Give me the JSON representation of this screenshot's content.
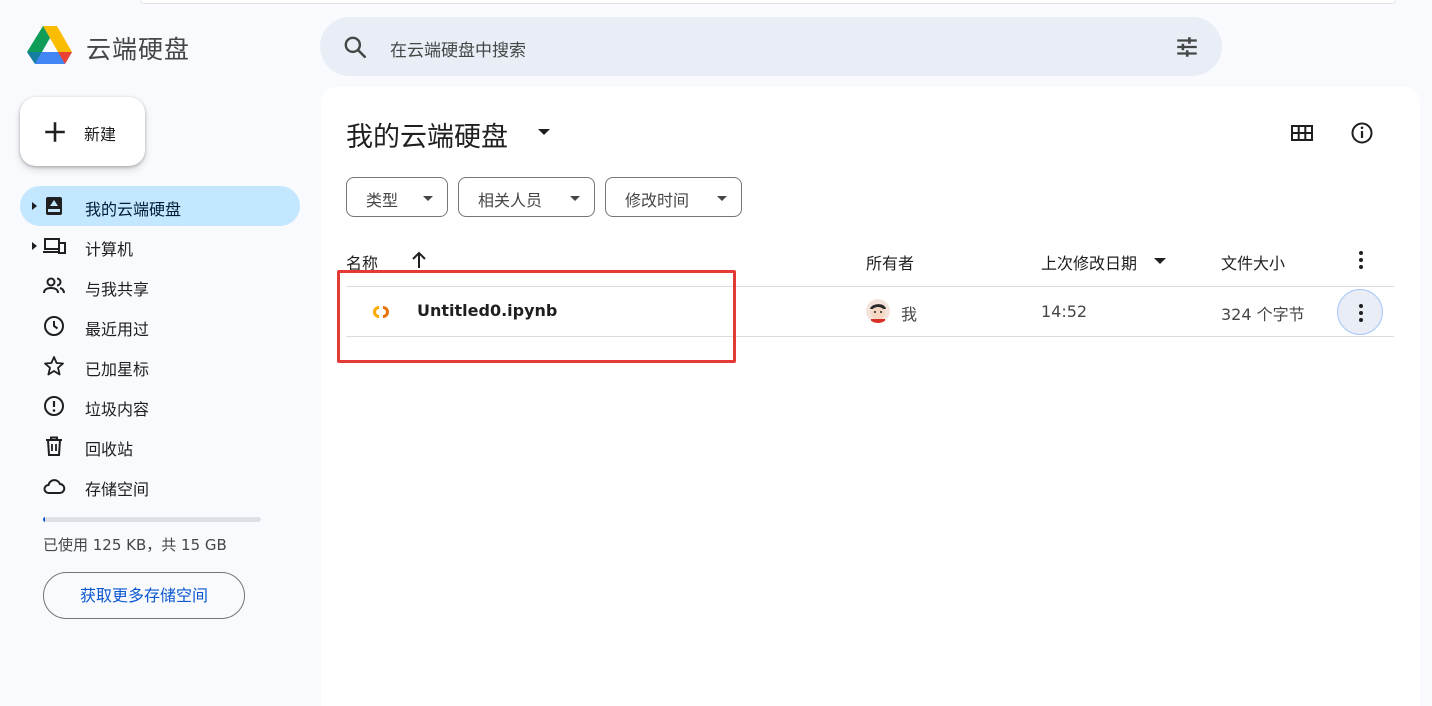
{
  "app": {
    "title": "云端硬盘"
  },
  "search": {
    "placeholder": "在云端硬盘中搜索"
  },
  "new_button": {
    "label": "新建"
  },
  "sidebar": {
    "items": [
      {
        "label": "我的云端硬盘",
        "icon": "my-drive-icon",
        "active": true,
        "expandable": true
      },
      {
        "label": "计算机",
        "icon": "computer-icon",
        "active": false,
        "expandable": true
      },
      {
        "label": "与我共享",
        "icon": "people-icon",
        "active": false
      },
      {
        "label": "最近用过",
        "icon": "clock-icon",
        "active": false
      },
      {
        "label": "已加星标",
        "icon": "star-icon",
        "active": false
      },
      {
        "label": "垃圾内容",
        "icon": "alert-icon",
        "active": false
      },
      {
        "label": "回收站",
        "icon": "trash-icon",
        "active": false
      },
      {
        "label": "存储空间",
        "icon": "cloud-icon",
        "active": false
      }
    ],
    "storage": {
      "used_text": "已使用 125 KB，共 15 GB",
      "used_fraction": 0.01,
      "button_label": "获取更多存储空间"
    }
  },
  "main": {
    "title": "我的云端硬盘",
    "filters": [
      {
        "label": "类型"
      },
      {
        "label": "相关人员"
      },
      {
        "label": "修改时间"
      }
    ],
    "columns": {
      "name": "名称",
      "owner": "所有者",
      "modified": "上次修改日期",
      "size": "文件大小"
    },
    "files": [
      {
        "name": "Untitled0.ipynb",
        "icon": "colab-icon",
        "owner": "我",
        "modified": "14:52",
        "size": "324 个字节"
      }
    ]
  },
  "colors": {
    "accent": "#0b57d0",
    "active_nav": "#c2e7ff",
    "search_bg": "#e9eef6",
    "highlight_box": "#e53935"
  }
}
